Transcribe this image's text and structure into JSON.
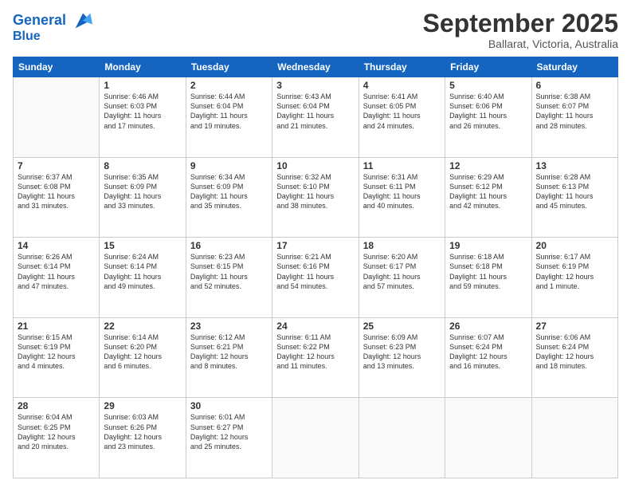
{
  "header": {
    "logo_line1": "General",
    "logo_line2": "Blue",
    "month": "September 2025",
    "location": "Ballarat, Victoria, Australia"
  },
  "days_of_week": [
    "Sunday",
    "Monday",
    "Tuesday",
    "Wednesday",
    "Thursday",
    "Friday",
    "Saturday"
  ],
  "weeks": [
    [
      {
        "day": "",
        "info": ""
      },
      {
        "day": "1",
        "info": "Sunrise: 6:46 AM\nSunset: 6:03 PM\nDaylight: 11 hours\nand 17 minutes."
      },
      {
        "day": "2",
        "info": "Sunrise: 6:44 AM\nSunset: 6:04 PM\nDaylight: 11 hours\nand 19 minutes."
      },
      {
        "day": "3",
        "info": "Sunrise: 6:43 AM\nSunset: 6:04 PM\nDaylight: 11 hours\nand 21 minutes."
      },
      {
        "day": "4",
        "info": "Sunrise: 6:41 AM\nSunset: 6:05 PM\nDaylight: 11 hours\nand 24 minutes."
      },
      {
        "day": "5",
        "info": "Sunrise: 6:40 AM\nSunset: 6:06 PM\nDaylight: 11 hours\nand 26 minutes."
      },
      {
        "day": "6",
        "info": "Sunrise: 6:38 AM\nSunset: 6:07 PM\nDaylight: 11 hours\nand 28 minutes."
      }
    ],
    [
      {
        "day": "7",
        "info": "Sunrise: 6:37 AM\nSunset: 6:08 PM\nDaylight: 11 hours\nand 31 minutes."
      },
      {
        "day": "8",
        "info": "Sunrise: 6:35 AM\nSunset: 6:09 PM\nDaylight: 11 hours\nand 33 minutes."
      },
      {
        "day": "9",
        "info": "Sunrise: 6:34 AM\nSunset: 6:09 PM\nDaylight: 11 hours\nand 35 minutes."
      },
      {
        "day": "10",
        "info": "Sunrise: 6:32 AM\nSunset: 6:10 PM\nDaylight: 11 hours\nand 38 minutes."
      },
      {
        "day": "11",
        "info": "Sunrise: 6:31 AM\nSunset: 6:11 PM\nDaylight: 11 hours\nand 40 minutes."
      },
      {
        "day": "12",
        "info": "Sunrise: 6:29 AM\nSunset: 6:12 PM\nDaylight: 11 hours\nand 42 minutes."
      },
      {
        "day": "13",
        "info": "Sunrise: 6:28 AM\nSunset: 6:13 PM\nDaylight: 11 hours\nand 45 minutes."
      }
    ],
    [
      {
        "day": "14",
        "info": "Sunrise: 6:26 AM\nSunset: 6:14 PM\nDaylight: 11 hours\nand 47 minutes."
      },
      {
        "day": "15",
        "info": "Sunrise: 6:24 AM\nSunset: 6:14 PM\nDaylight: 11 hours\nand 49 minutes."
      },
      {
        "day": "16",
        "info": "Sunrise: 6:23 AM\nSunset: 6:15 PM\nDaylight: 11 hours\nand 52 minutes."
      },
      {
        "day": "17",
        "info": "Sunrise: 6:21 AM\nSunset: 6:16 PM\nDaylight: 11 hours\nand 54 minutes."
      },
      {
        "day": "18",
        "info": "Sunrise: 6:20 AM\nSunset: 6:17 PM\nDaylight: 11 hours\nand 57 minutes."
      },
      {
        "day": "19",
        "info": "Sunrise: 6:18 AM\nSunset: 6:18 PM\nDaylight: 11 hours\nand 59 minutes."
      },
      {
        "day": "20",
        "info": "Sunrise: 6:17 AM\nSunset: 6:19 PM\nDaylight: 12 hours\nand 1 minute."
      }
    ],
    [
      {
        "day": "21",
        "info": "Sunrise: 6:15 AM\nSunset: 6:19 PM\nDaylight: 12 hours\nand 4 minutes."
      },
      {
        "day": "22",
        "info": "Sunrise: 6:14 AM\nSunset: 6:20 PM\nDaylight: 12 hours\nand 6 minutes."
      },
      {
        "day": "23",
        "info": "Sunrise: 6:12 AM\nSunset: 6:21 PM\nDaylight: 12 hours\nand 8 minutes."
      },
      {
        "day": "24",
        "info": "Sunrise: 6:11 AM\nSunset: 6:22 PM\nDaylight: 12 hours\nand 11 minutes."
      },
      {
        "day": "25",
        "info": "Sunrise: 6:09 AM\nSunset: 6:23 PM\nDaylight: 12 hours\nand 13 minutes."
      },
      {
        "day": "26",
        "info": "Sunrise: 6:07 AM\nSunset: 6:24 PM\nDaylight: 12 hours\nand 16 minutes."
      },
      {
        "day": "27",
        "info": "Sunrise: 6:06 AM\nSunset: 6:24 PM\nDaylight: 12 hours\nand 18 minutes."
      }
    ],
    [
      {
        "day": "28",
        "info": "Sunrise: 6:04 AM\nSunset: 6:25 PM\nDaylight: 12 hours\nand 20 minutes."
      },
      {
        "day": "29",
        "info": "Sunrise: 6:03 AM\nSunset: 6:26 PM\nDaylight: 12 hours\nand 23 minutes."
      },
      {
        "day": "30",
        "info": "Sunrise: 6:01 AM\nSunset: 6:27 PM\nDaylight: 12 hours\nand 25 minutes."
      },
      {
        "day": "",
        "info": ""
      },
      {
        "day": "",
        "info": ""
      },
      {
        "day": "",
        "info": ""
      },
      {
        "day": "",
        "info": ""
      }
    ]
  ]
}
